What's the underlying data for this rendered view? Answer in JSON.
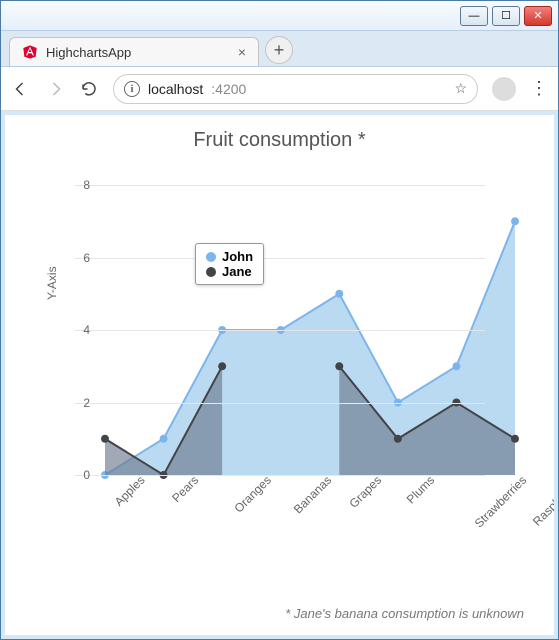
{
  "window": {
    "minimize": "—",
    "maximize": "☐",
    "close": "✕"
  },
  "tab": {
    "title": "HighchartsApp",
    "close": "×",
    "newtab": "+"
  },
  "nav": {
    "url_host": "localhost",
    "url_port": ":4200"
  },
  "chart_data": {
    "type": "area",
    "title": "Fruit consumption *",
    "ylabel": "Y-Axis",
    "ylim": [
      0,
      8
    ],
    "yticks": [
      0,
      2,
      4,
      6,
      8
    ],
    "categories": [
      "Apples",
      "Pears",
      "Oranges",
      "Bananas",
      "Grapes",
      "Plums",
      "Strawberries",
      "Raspberries"
    ],
    "series": [
      {
        "name": "John",
        "color": "#95c6eb",
        "line": "#7cb5ec",
        "values": [
          0,
          1,
          4,
          4,
          5,
          2,
          3,
          7
        ]
      },
      {
        "name": "Jane",
        "color": "#6d7b8d",
        "line": "#434348",
        "values": [
          1,
          0,
          3,
          null,
          3,
          1,
          2,
          1
        ]
      }
    ],
    "caption": "* Jane's banana consumption is unknown"
  }
}
